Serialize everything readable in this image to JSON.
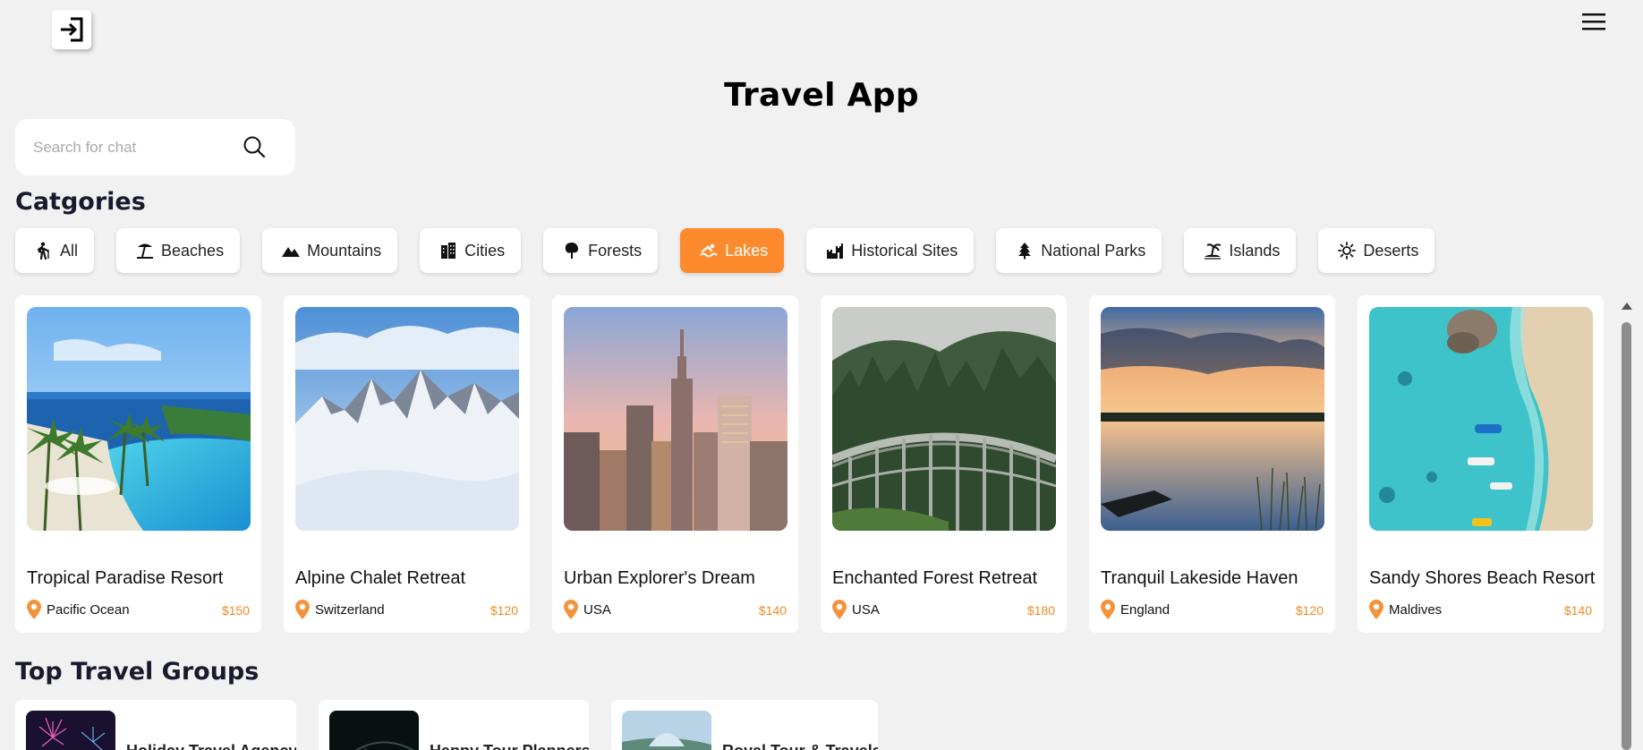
{
  "app": {
    "title": "Travel App"
  },
  "search": {
    "placeholder": "Search for chat"
  },
  "categories": {
    "title": "Catgories",
    "active": "Lakes",
    "items": [
      {
        "label": "All",
        "icon": "hiking-icon"
      },
      {
        "label": "Beaches",
        "icon": "beach-umbrella-icon"
      },
      {
        "label": "Mountains",
        "icon": "mountain-icon"
      },
      {
        "label": "Cities",
        "icon": "city-icon"
      },
      {
        "label": "Forests",
        "icon": "tree-icon"
      },
      {
        "label": "Lakes",
        "icon": "swimmer-icon"
      },
      {
        "label": "Historical Sites",
        "icon": "castle-icon"
      },
      {
        "label": "National Parks",
        "icon": "pine-tree-icon"
      },
      {
        "label": "Islands",
        "icon": "island-icon"
      },
      {
        "label": "Deserts",
        "icon": "sun-icon"
      }
    ]
  },
  "destinations": [
    {
      "title": "Tropical Paradise Resort",
      "location": "Pacific Ocean",
      "price": "$150"
    },
    {
      "title": "Alpine Chalet Retreat",
      "location": "Switzerland",
      "price": "$120"
    },
    {
      "title": "Urban Explorer's Dream",
      "location": "USA",
      "price": "$140"
    },
    {
      "title": "Enchanted Forest Retreat",
      "location": "USA",
      "price": "$180"
    },
    {
      "title": "Tranquil Lakeside Haven",
      "location": "England",
      "price": "$120"
    },
    {
      "title": "Sandy Shores Beach Resort",
      "location": "Maldives",
      "price": "$140"
    }
  ],
  "groups": {
    "title": "Top Travel Groups",
    "items": [
      {
        "name": "Holiday Travel Agency"
      },
      {
        "name": "Happy Tour Planners"
      },
      {
        "name": "Royal Tour & Travels"
      }
    ]
  },
  "colors": {
    "accent": "#fd8a2c",
    "price": "#f08a24",
    "background": "#f1f1f1"
  }
}
